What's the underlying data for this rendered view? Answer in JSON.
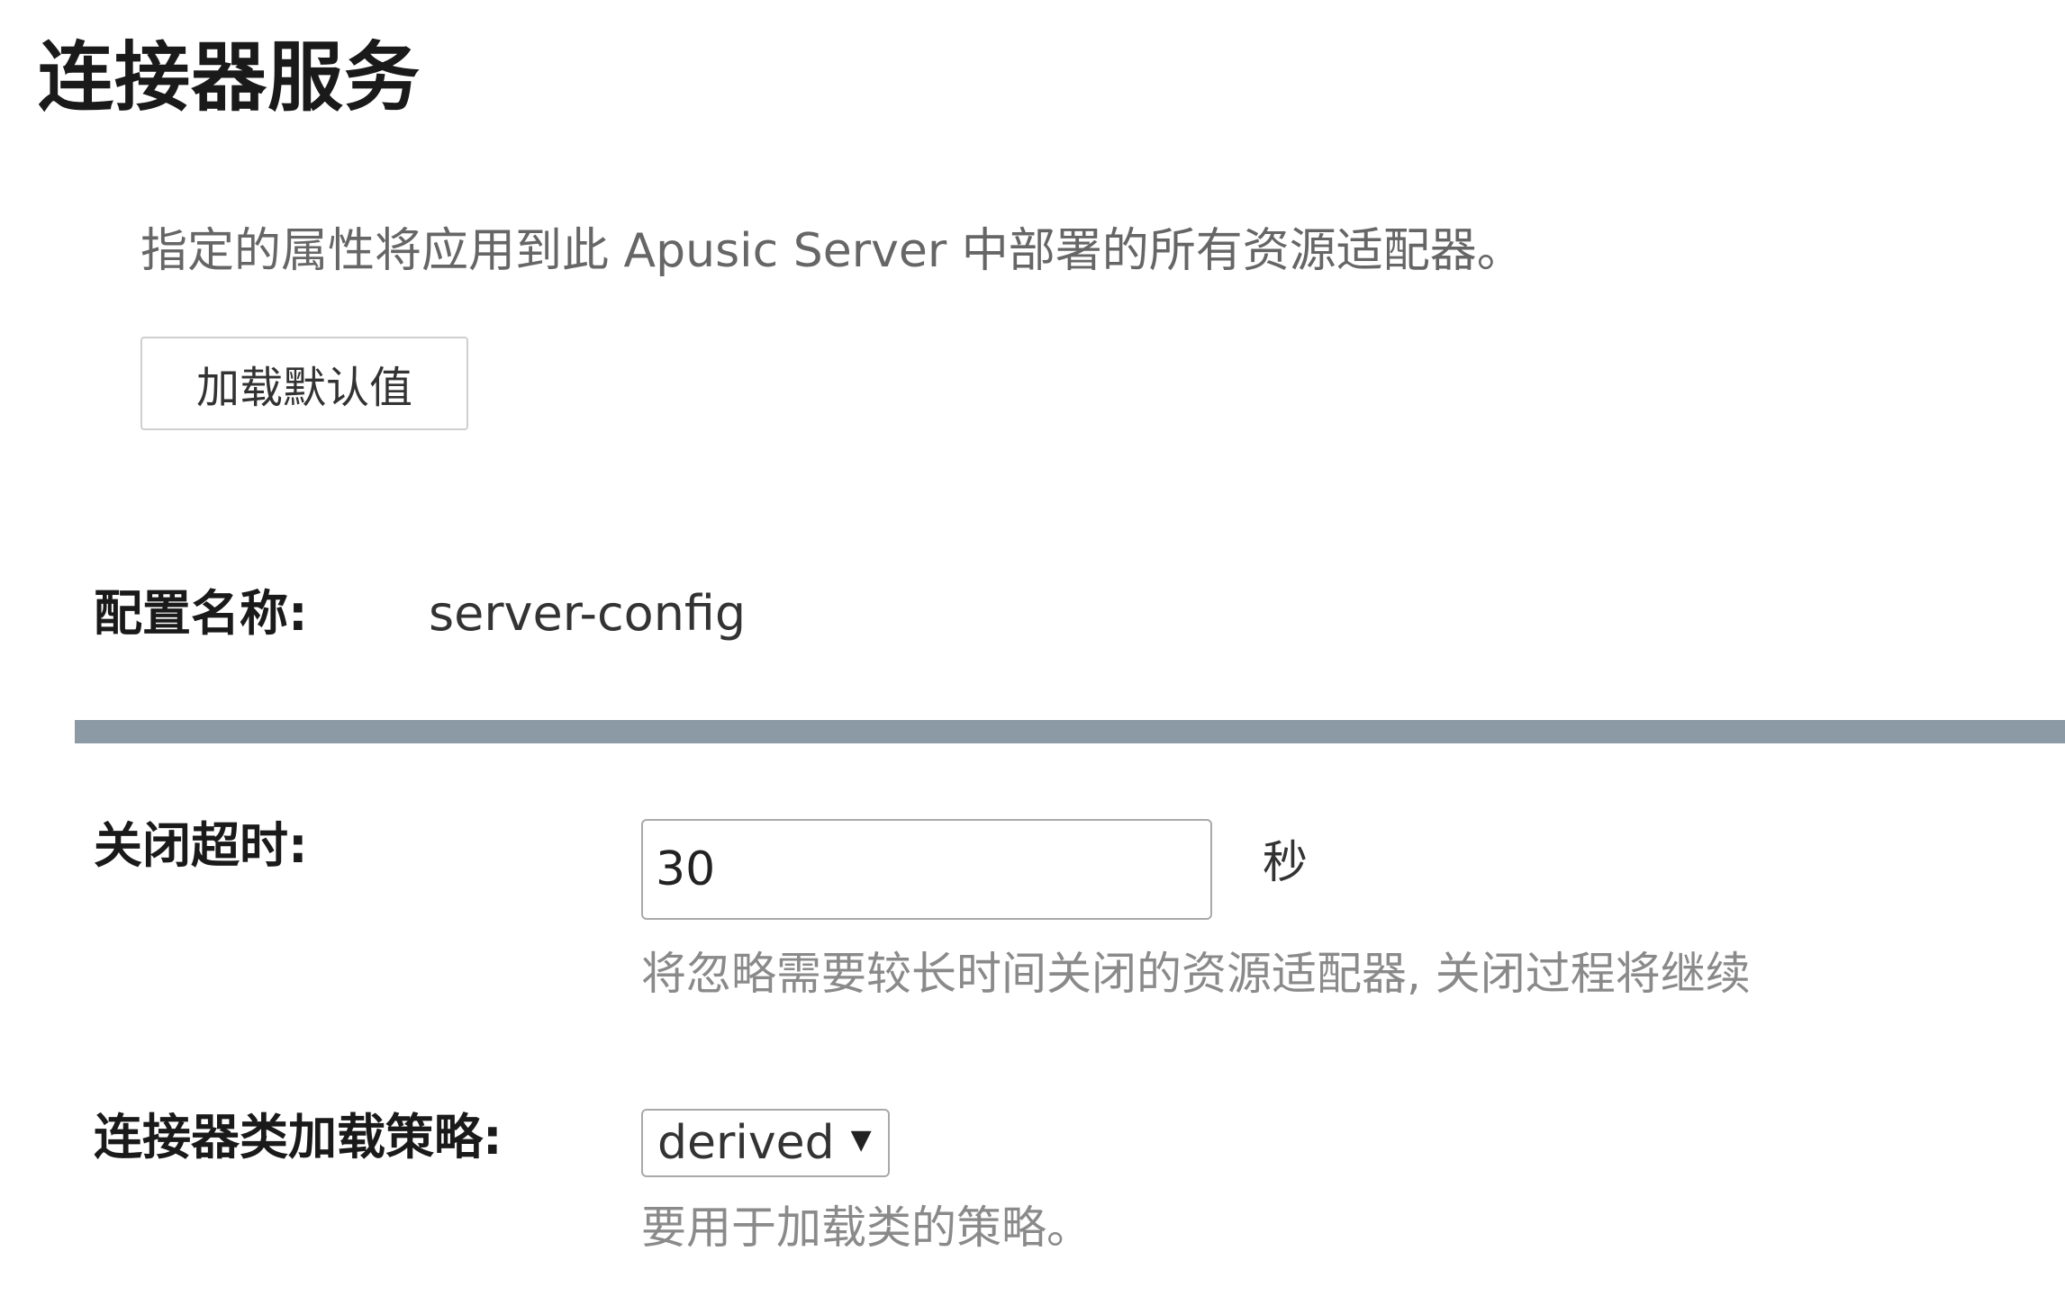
{
  "header": {
    "title": "连接器服务",
    "description": "指定的属性将应用到此 Apusic Server 中部署的所有资源适配器。"
  },
  "toolbar": {
    "load_defaults_label": "加载默认值"
  },
  "config": {
    "label": "配置名称:",
    "value": "server-config"
  },
  "shutdown_timeout": {
    "label": "关闭超时:",
    "value": "30",
    "unit": "秒",
    "help": "将忽略需要较长时间关闭的资源适配器, 关闭过程将继续"
  },
  "class_loading": {
    "label": "连接器类加载策略:",
    "selected": "derived",
    "help": "要用于加载类的策略。"
  },
  "colors": {
    "divider": "#8b9aa4",
    "help_text": "#8a8a8a"
  },
  "icons": {
    "select_arrow": "triangle-down-icon"
  }
}
